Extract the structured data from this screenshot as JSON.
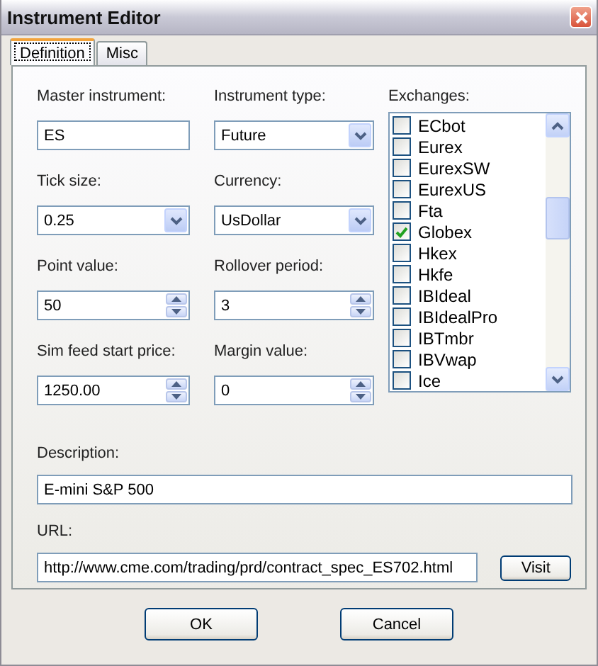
{
  "window": {
    "title": "Instrument Editor"
  },
  "tabs": [
    {
      "label": "Definition",
      "selected": true
    },
    {
      "label": "Misc",
      "selected": false
    }
  ],
  "fields": [
    {
      "label": "Master instrument:",
      "value": "ES",
      "kind": "text"
    },
    {
      "label": "Instrument type:",
      "value": "Future",
      "kind": "dropdown"
    },
    {
      "label": "Tick size:",
      "value": "0.25",
      "kind": "dropdown"
    },
    {
      "label": "Currency:",
      "value": "UsDollar",
      "kind": "dropdown"
    },
    {
      "label": "Point value:",
      "value": "50",
      "kind": "spinner"
    },
    {
      "label": "Rollover period:",
      "value": "3",
      "kind": "spinner"
    },
    {
      "label": "Sim feed start price:",
      "value": "1250.00",
      "kind": "spinner"
    },
    {
      "label": "Margin value:",
      "value": "0",
      "kind": "spinner"
    }
  ],
  "exchanges": {
    "label": "Exchanges:",
    "items": [
      {
        "label": "ECbot",
        "checked": false
      },
      {
        "label": "Eurex",
        "checked": false
      },
      {
        "label": "EurexSW",
        "checked": false
      },
      {
        "label": "EurexUS",
        "checked": false
      },
      {
        "label": "Fta",
        "checked": false
      },
      {
        "label": "Globex",
        "checked": true
      },
      {
        "label": "Hkex",
        "checked": false
      },
      {
        "label": "Hkfe",
        "checked": false
      },
      {
        "label": "IBIdeal",
        "checked": false
      },
      {
        "label": "IBIdealPro",
        "checked": false
      },
      {
        "label": "IBTmbr",
        "checked": false
      },
      {
        "label": "IBVwap",
        "checked": false
      },
      {
        "label": "Ice",
        "checked": false
      }
    ]
  },
  "description": {
    "label": "Description:",
    "value": "E-mini S&P 500"
  },
  "url": {
    "label": "URL:",
    "value": "http://www.cme.com/trading/prd/contract_spec_ES702.html",
    "button": "Visit"
  },
  "buttons": [
    "OK",
    "Cancel"
  ]
}
